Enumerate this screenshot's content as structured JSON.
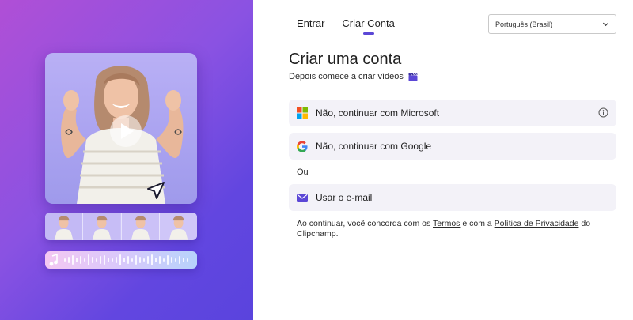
{
  "tabs": [
    {
      "label": "Entrar",
      "active": false
    },
    {
      "label": "Criar Conta",
      "active": true
    }
  ],
  "language": {
    "selected": "Português (Brasil)"
  },
  "heading": {
    "title": "Criar uma conta",
    "subtitle": "Depois comece a criar vídeos",
    "subtitle_icon": "clapperboard-icon"
  },
  "options": {
    "microsoft": {
      "label": "Não, continuar com Microsoft",
      "icon": "microsoft-logo-icon"
    },
    "google": {
      "label": "Não, continuar com Google",
      "icon": "google-logo-icon"
    },
    "or": "Ou",
    "email": {
      "label": "Usar o e-mail",
      "icon": "envelope-icon"
    }
  },
  "legal": {
    "prefix": "Ao continuar, você concorda com os ",
    "terms": "Termos",
    "middle": " e com a ",
    "privacy": "Política de Privacidade",
    "suffix": " do Clipchamp."
  },
  "colors": {
    "accent": "#5b47d6",
    "hero_start": "#b04fd6",
    "hero_end": "#5a44dd",
    "option_bg": "#f3f2f8"
  }
}
